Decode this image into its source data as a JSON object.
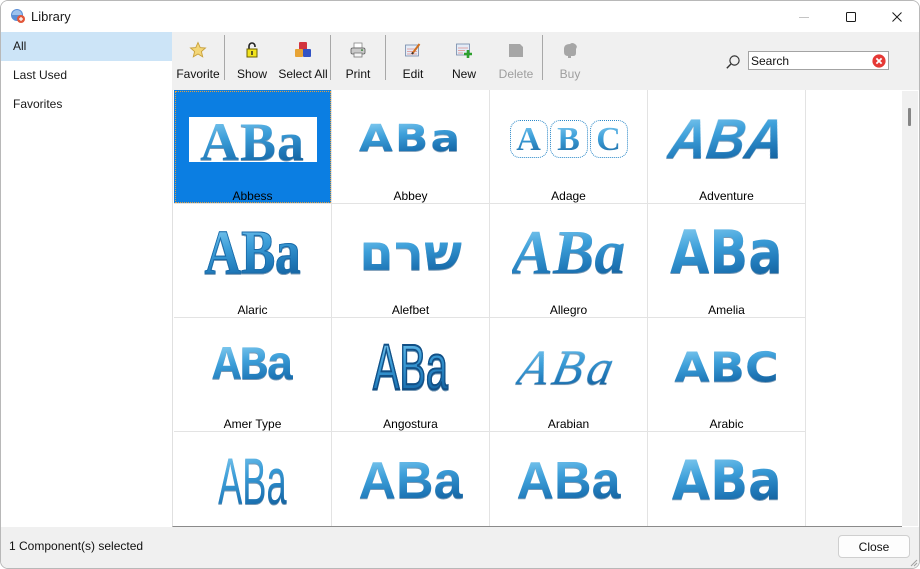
{
  "window": {
    "title": "Library",
    "app_icon": "library-app-icon",
    "controls": {
      "minimize": "minimize-icon",
      "maximize": "maximize-icon",
      "close": "close-icon"
    }
  },
  "sidebar": {
    "items": [
      {
        "label": "All",
        "selected": true
      },
      {
        "label": "Last Used",
        "selected": false
      },
      {
        "label": "Favorites",
        "selected": false
      }
    ]
  },
  "toolbar": {
    "buttons": [
      {
        "label": "Favorite",
        "icon": "star-icon",
        "enabled": true
      },
      {
        "label": "Show",
        "icon": "unlock-icon",
        "enabled": true
      },
      {
        "label": "Select All",
        "icon": "cubes-icon",
        "enabled": true
      },
      {
        "label": "Print",
        "icon": "printer-icon",
        "enabled": true
      },
      {
        "label": "Edit",
        "icon": "edit-icon",
        "enabled": true
      },
      {
        "label": "New",
        "icon": "new-icon",
        "enabled": true
      },
      {
        "label": "Delete",
        "icon": "delete-icon",
        "enabled": false
      },
      {
        "label": "Buy",
        "icon": "buy-icon",
        "enabled": false
      }
    ]
  },
  "search": {
    "value": "Search",
    "icon": "search-icon",
    "clear_icon": "clear-icon"
  },
  "grid": {
    "selected_index": 0,
    "items": [
      {
        "name": "Abbess",
        "sample": "ABa"
      },
      {
        "name": "Abbey",
        "sample": "ABa"
      },
      {
        "name": "Adage",
        "sample": "ABC"
      },
      {
        "name": "Adventure",
        "sample": "ABA"
      },
      {
        "name": "Alaric",
        "sample": "ABa"
      },
      {
        "name": "Alefbet",
        "sample": "שרם"
      },
      {
        "name": "Allegro",
        "sample": "ABa"
      },
      {
        "name": "Amelia",
        "sample": "ABa"
      },
      {
        "name": "Amer Type",
        "sample": "ABa"
      },
      {
        "name": "Angostura",
        "sample": "ABa"
      },
      {
        "name": "Arabian",
        "sample": "ABa"
      },
      {
        "name": "Arabic",
        "sample": "ABC"
      },
      {
        "sample": "ABa"
      },
      {
        "sample": "ABa"
      },
      {
        "sample": "ABa"
      },
      {
        "sample": "ABa"
      }
    ]
  },
  "status": {
    "text": "1 Component(s) selected"
  },
  "footer": {
    "close_label": "Close"
  },
  "colors": {
    "selection": "#0b7ee2",
    "sidebar_selection": "#cce4f7",
    "thumbnail_blue": "#2a8fcf",
    "clear_red": "#e53935",
    "disabled_text": "#9e9e9e"
  }
}
